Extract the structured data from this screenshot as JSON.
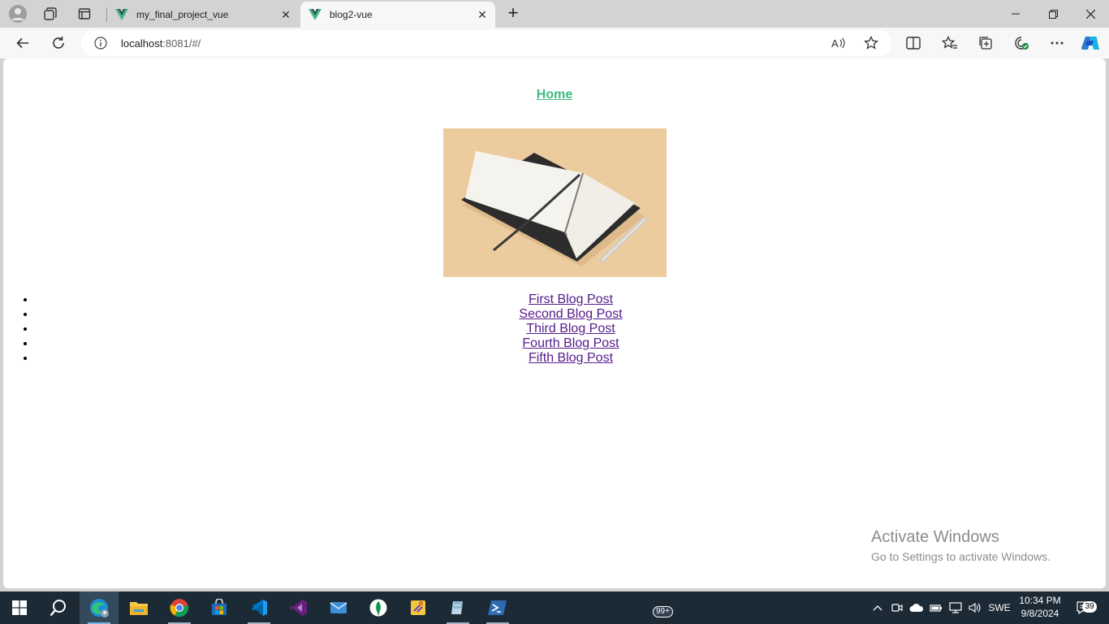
{
  "browser": {
    "tabs": [
      {
        "title": "my_final_project_vue",
        "active": false
      },
      {
        "title": "blog2-vue",
        "active": true
      }
    ],
    "address": {
      "host": "localhost",
      "rest": ":8081/#/"
    }
  },
  "page": {
    "home_link": "Home",
    "hero_image_alt": "open notebook with pen",
    "posts": [
      "First Blog Post",
      "Second Blog Post",
      "Third Blog Post",
      "Fourth Blog Post",
      "Fifth Blog Post"
    ],
    "watermark": {
      "line1": "Activate Windows",
      "line2": "Go to Settings to activate Windows."
    }
  },
  "taskbar": {
    "language": "SWE",
    "time": "10:34 PM",
    "date": "9/8/2024",
    "notification_count": "39",
    "mail_badge": "99+"
  },
  "colors": {
    "link_home": "#42b983",
    "link_visited": "#551a8b",
    "taskbar_bg": "#1c2a36"
  }
}
